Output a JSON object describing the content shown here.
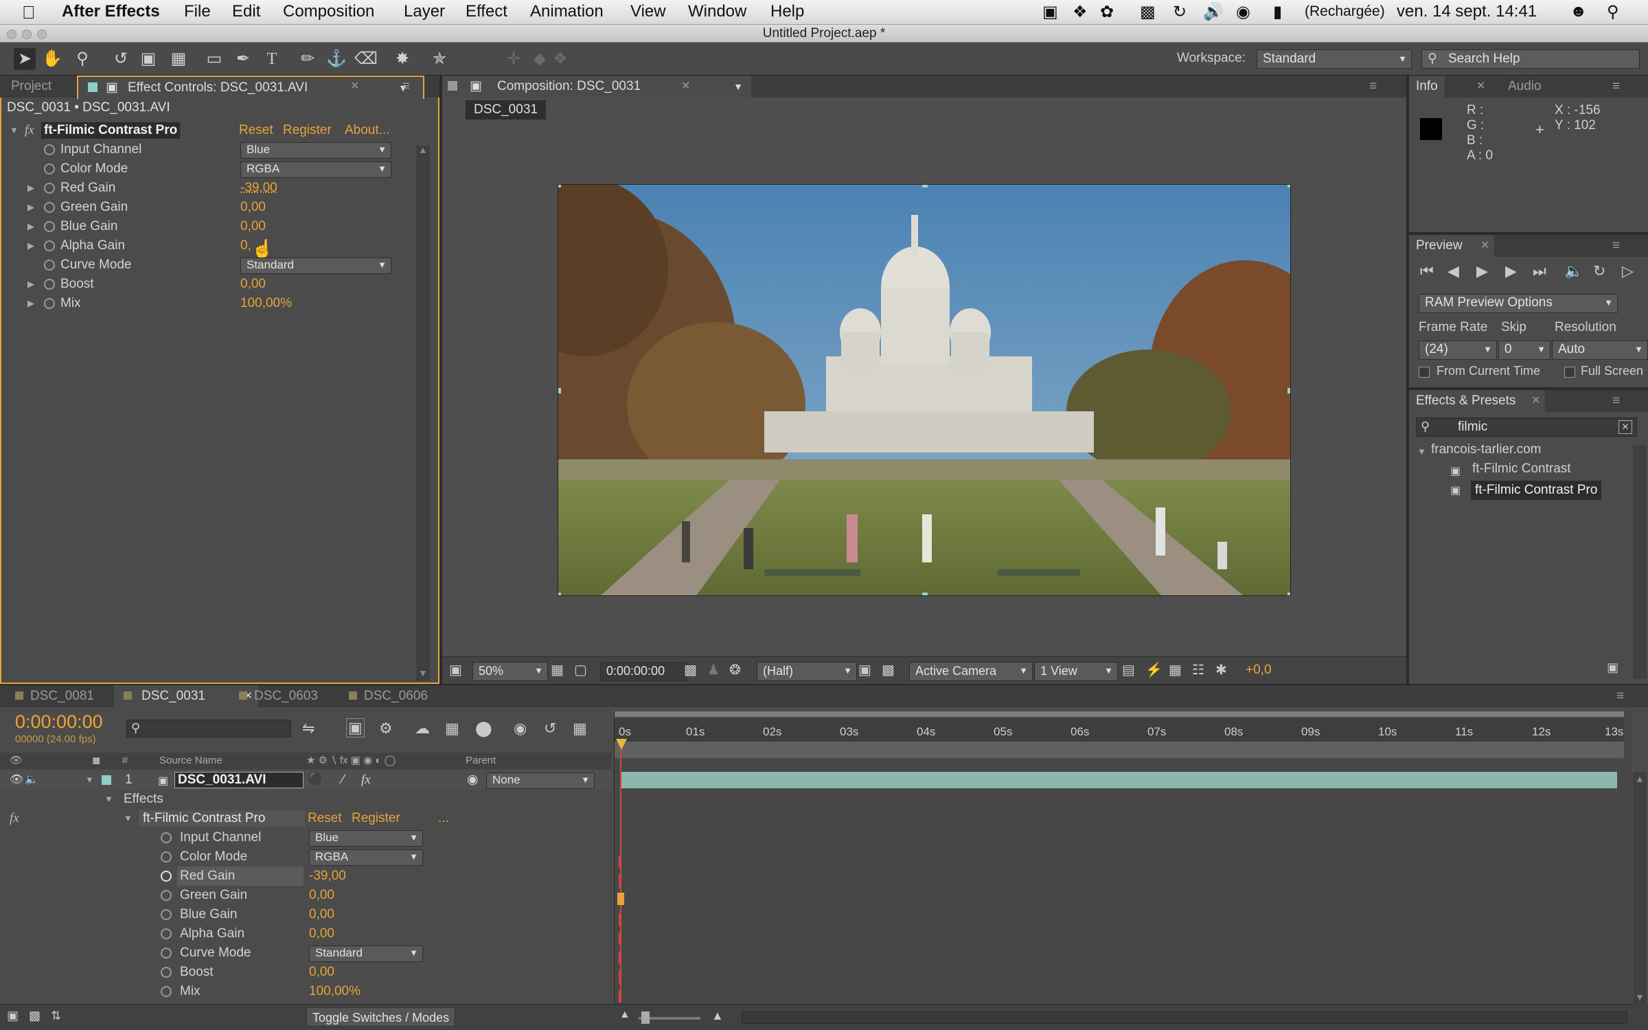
{
  "menubar": {
    "app_name": "After Effects",
    "items": [
      "File",
      "Edit",
      "Composition",
      "Layer",
      "Effect",
      "Animation",
      "View",
      "Window",
      "Help"
    ],
    "battery_status": "(Rechargée)",
    "datetime": "ven. 14 sept.  14:41"
  },
  "window": {
    "title": "Untitled Project.aep *"
  },
  "toolbar": {
    "workspace_label": "Workspace:",
    "workspace_value": "Standard",
    "search_placeholder": "Search Help"
  },
  "left_panel": {
    "tab_project": "Project",
    "tab_effect_controls": "Effect Controls: DSC_0031.AVI",
    "breadcrumb": "DSC_0031 • DSC_0031.AVI",
    "effect": {
      "fx": "fx",
      "name": "ft-Filmic Contrast Pro",
      "reset": "Reset",
      "register": "Register",
      "about": "About..."
    },
    "params": [
      {
        "name": "Input Channel",
        "dropdown": "Blue"
      },
      {
        "name": "Color Mode",
        "dropdown": "RGBA"
      },
      {
        "name": "Red Gain",
        "value": "-39,00"
      },
      {
        "name": "Green Gain",
        "value": "0,00"
      },
      {
        "name": "Blue Gain",
        "value": "0,00"
      },
      {
        "name": "Alpha Gain",
        "value": "0,"
      },
      {
        "name": "Curve Mode",
        "dropdown": "Standard"
      },
      {
        "name": "Boost",
        "value": "0,00"
      },
      {
        "name": "Mix",
        "value": "100,00%"
      }
    ]
  },
  "composition": {
    "tab": "Composition: DSC_0031",
    "chip": "DSC_0031",
    "footer": {
      "zoom": "50%",
      "timecode": "0:00:00:00",
      "resolution": "(Half)",
      "camera": "Active Camera",
      "views": "1 View",
      "exposure": "+0,0"
    }
  },
  "info": {
    "tab_info": "Info",
    "tab_audio": "Audio",
    "r": "R :",
    "g": "G :",
    "b": "B :",
    "a": "A : 0",
    "x": "X : -156",
    "y": "Y : 102"
  },
  "preview": {
    "tab": "Preview",
    "ram_options": "RAM Preview Options",
    "frame_rate_label": "Frame Rate",
    "skip_label": "Skip",
    "resolution_label": "Resolution",
    "frame_rate": "(24)",
    "skip": "0",
    "resolution": "Auto",
    "from_current_time": "From Current Time",
    "full_screen": "Full Screen"
  },
  "effects_presets": {
    "tab": "Effects & Presets",
    "search": "filmic",
    "folder": "francois-tarlier.com",
    "items": [
      "ft-Filmic Contrast",
      "ft-Filmic Contrast Pro"
    ]
  },
  "timeline": {
    "tabs": [
      "DSC_0081",
      "DSC_0031",
      "DSC_0603",
      "DSC_0606"
    ],
    "timecode": "0:00:00:00",
    "frame_info": "00000 (24.00 fps)",
    "col_source": "Source Name",
    "col_hash": "#",
    "col_parent": "Parent",
    "ruler": [
      "0s",
      "01s",
      "02s",
      "03s",
      "04s",
      "05s",
      "06s",
      "07s",
      "08s",
      "09s",
      "10s",
      "11s",
      "12s",
      "13s"
    ],
    "layer": {
      "index": "1",
      "name": "DSC_0031.AVI",
      "parent": "None"
    },
    "effects_label": "Effects",
    "effect_name": "ft-Filmic Contrast Pro",
    "reset": "Reset",
    "register": "Register",
    "more": "...",
    "params": [
      {
        "name": "Input Channel",
        "dropdown": "Blue"
      },
      {
        "name": "Color Mode",
        "dropdown": "RGBA"
      },
      {
        "name": "Red Gain",
        "value": "-39,00"
      },
      {
        "name": "Green Gain",
        "value": "0,00"
      },
      {
        "name": "Blue Gain",
        "value": "0,00"
      },
      {
        "name": "Alpha Gain",
        "value": "0,00"
      },
      {
        "name": "Curve Mode",
        "dropdown": "Standard"
      },
      {
        "name": "Boost",
        "value": "0,00"
      },
      {
        "name": "Mix",
        "value": "100,00%"
      }
    ],
    "toggle_label": "Toggle Switches / Modes"
  }
}
